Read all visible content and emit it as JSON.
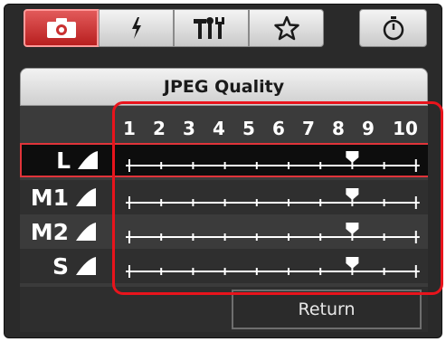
{
  "tabs": [
    {
      "name": "camera",
      "icon": "camera-icon",
      "active": true
    },
    {
      "name": "flash",
      "icon": "flash-icon",
      "active": false
    },
    {
      "name": "tools",
      "icon": "tools-icon",
      "active": false
    },
    {
      "name": "star",
      "icon": "star-icon",
      "active": false
    },
    {
      "name": "timer",
      "icon": "timer-icon",
      "active": false
    }
  ],
  "panel": {
    "title": "JPEG Quality",
    "scale_numbers": [
      "1",
      "2",
      "3",
      "4",
      "5",
      "6",
      "7",
      "8",
      "9",
      "10"
    ],
    "rows": [
      {
        "label": "L",
        "value": 8,
        "selected": true
      },
      {
        "label": "M1",
        "value": 8,
        "selected": false
      },
      {
        "label": "M2",
        "value": 8,
        "selected": false
      },
      {
        "label": "S",
        "value": 8,
        "selected": false
      }
    ],
    "return_label": "Return"
  },
  "colors": {
    "accent_red": "#e8141c",
    "active_tab": "#c93030",
    "panel_bg": "#3b3b3b"
  }
}
